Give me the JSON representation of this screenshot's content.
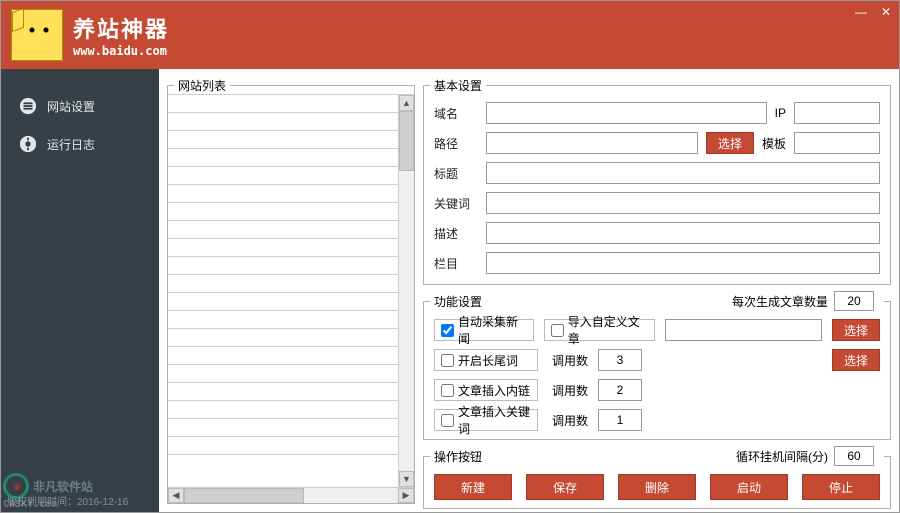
{
  "header": {
    "title": "养站神器",
    "url": "www.baidu.com"
  },
  "sidebar": {
    "items": [
      {
        "label": "网站设置"
      },
      {
        "label": "运行日志"
      }
    ],
    "footer": "版权到期时间：2016-12-16"
  },
  "listPanel": {
    "title": "网站列表"
  },
  "basic": {
    "title": "基本设置",
    "labels": {
      "domain": "域名",
      "ip": "IP",
      "path": "路径",
      "select": "选择",
      "template": "模板",
      "title_f": "标题",
      "keywords": "关键词",
      "desc": "描述",
      "column": "栏目"
    },
    "values": {
      "domain": "",
      "ip": "",
      "path": "",
      "template": "",
      "title_f": "",
      "keywords": "",
      "desc": "",
      "column": ""
    }
  },
  "func": {
    "title": "功能设置",
    "genCountLabel": "每次生成文章数量",
    "genCount": "20",
    "autoCollect": "自动采集新闻",
    "importCustom": "导入自定义文章",
    "customPath": "",
    "selectBtn": "选择",
    "longtail": "开启长尾词",
    "callLabel": "调用数",
    "callLongtail": "3",
    "innerLink": "文章插入内链",
    "callInner": "2",
    "insertKw": "文章插入关键词",
    "callKw": "1"
  },
  "ops": {
    "title": "操作按钮",
    "loopLabel": "循环挂机间隔(分)",
    "loopValue": "60",
    "buttons": {
      "new": "新建",
      "save": "保存",
      "del": "删除",
      "start": "启动",
      "stop": "停止"
    }
  },
  "watermark": {
    "name": "非凡软件站",
    "url": "CRSKY.com"
  }
}
